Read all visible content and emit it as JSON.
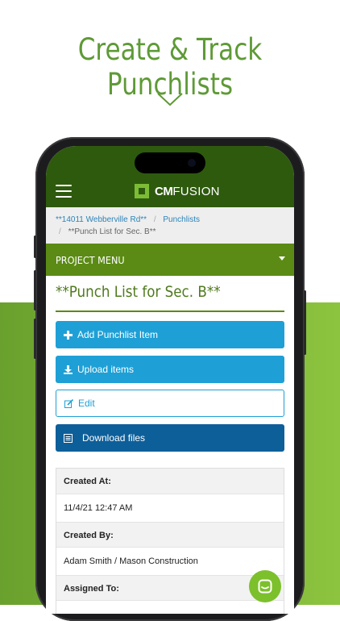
{
  "headline": "Create & Track Punchlists",
  "colors": {
    "brand_green": "#5e9a36",
    "appbar": "#2e5a0e",
    "menu_green": "#5b8b14",
    "button_blue": "#1ea0d6",
    "button_dark": "#0d5f9a"
  },
  "app": {
    "logo_bold": "CM",
    "logo_light": "FUSION"
  },
  "breadcrumb": {
    "items": [
      "**14011 Webberville Rd**",
      "Punchlists",
      "**Punch List for Sec. B**"
    ],
    "separator": "/"
  },
  "project_menu": {
    "label": "PROJECT MENU"
  },
  "page_title": "**Punch List for Sec. B**",
  "buttons": {
    "add": "Add Punchlist Item",
    "upload": "Upload items",
    "edit": "Edit",
    "download": "Download files"
  },
  "details": {
    "created_at_label": "Created At:",
    "created_at_value": "11/4/21 12:47 AM",
    "created_by_label": "Created By:",
    "created_by_value": "Adam Smith / Mason Construction",
    "assigned_to_label": "Assigned To:"
  },
  "icons": [
    "chevron-down-icon",
    "hamburger-icon",
    "plus-icon",
    "download-icon",
    "edit-icon",
    "list-icon",
    "chat-icon"
  ]
}
